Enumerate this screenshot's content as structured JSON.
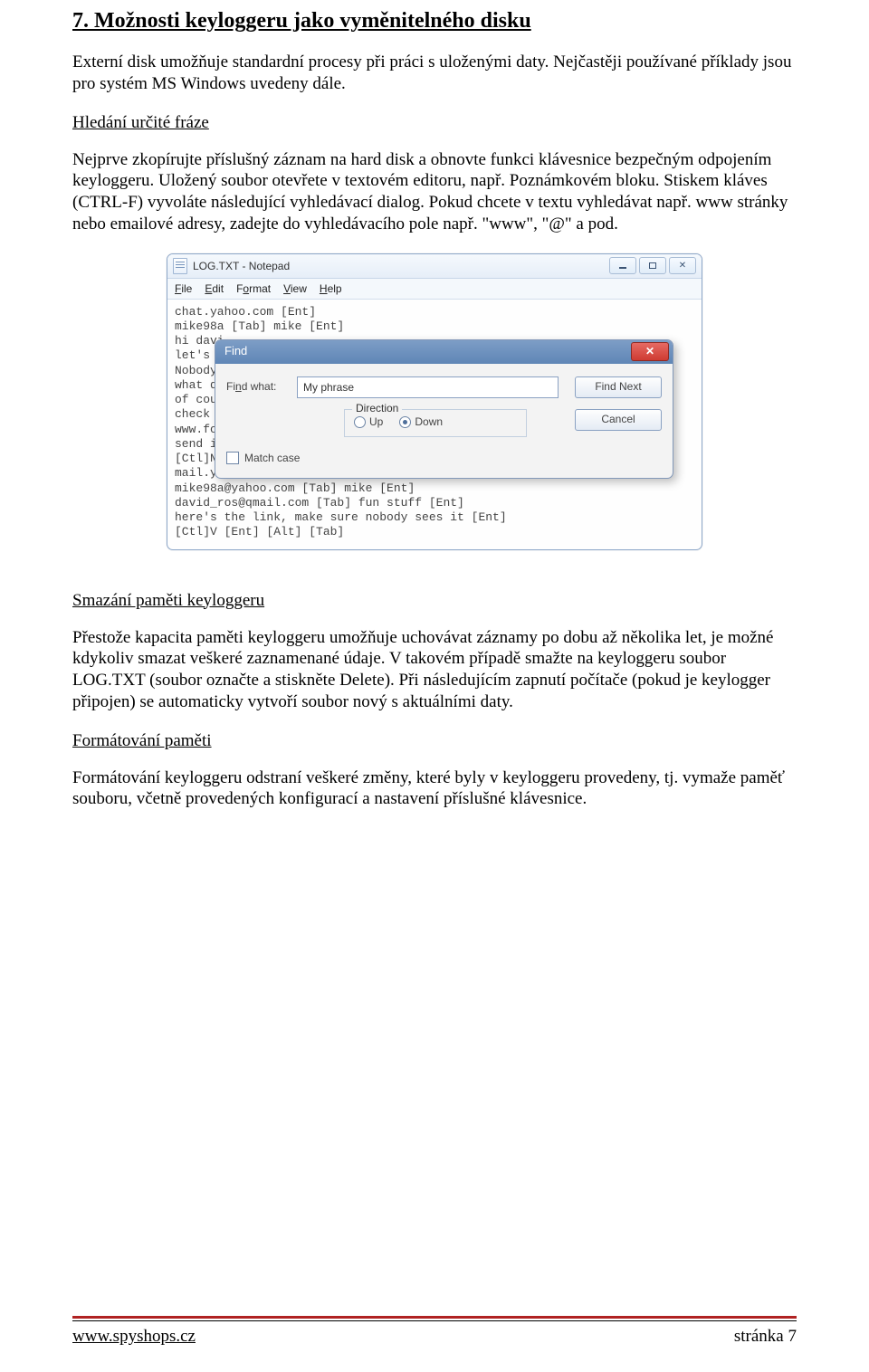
{
  "heading_number": "7.",
  "heading_text": "Možnosti keyloggeru jako vyměnitelného disku",
  "para1": "Externí disk umožňuje standardní procesy při práci s uloženými daty. Nejčastěji používané příklady jsou pro systém MS Windows uvedeny dále.",
  "sub1": "Hledání určité fráze",
  "para2": "Nejprve zkopírujte příslušný záznam na hard disk a obnovte funkci klávesnice bezpečným odpojením keyloggeru. Uložený soubor otevřete v textovém editoru, např. Poznámkovém bloku. Stiskem kláves (CTRL-F) vyvoláte následující vyhledávací dialog. Pokud chcete v textu vyhledávat např. www stránky nebo emailové adresy, zadejte do vyhledávacího pole např. \"www\", \"@\" a pod.",
  "sub2": "Smazání paměti keyloggeru",
  "para3": "Přestože kapacita paměti keyloggeru umožňuje uchovávat záznamy po dobu až několika let, je možné kdykoliv smazat veškeré zaznamenané údaje. V takovém případě smažte na keyloggeru soubor LOG.TXT (soubor označte a stiskněte Delete). Při následujícím zapnutí počítače (pokud je keylogger připojen) se automaticky vytvoří soubor nový s aktuálními daty.",
  "sub3": "Formátování paměti",
  "para4": "Formátování keyloggeru odstraní veškeré změny, které byly v keyloggeru provedeny, tj. vymaže paměť souboru, včetně provedených konfigurací a nastavení příslušné klávesnice.",
  "notepad": {
    "title": "LOG.TXT - Notepad",
    "menu": {
      "file": "File",
      "edit": "Edit",
      "format": "Format",
      "view": "View",
      "help": "Help"
    },
    "body_lines": [
      "chat.yahoo.com [Ent]",
      "mike98a [Tab] mike [Ent]",
      "hi davi",
      "let's s",
      "Nobody",
      "what do",
      "of cour",
      "check o",
      "www.for",
      "send it",
      "[Ctl]N",
      "mail.ya",
      "mike98a@yahoo.com [Tab] mike [Ent]",
      "david_ros@qmail.com [Tab] fun stuff [Ent]",
      "here's the link, make sure nobody sees it [Ent]",
      "[Ctl]V [Ent] [Alt] [Tab]"
    ]
  },
  "find": {
    "title": "Find",
    "label": "Find what:",
    "value": "My phrase",
    "find_next": "Find Next",
    "cancel": "Cancel",
    "direction": "Direction",
    "up": "Up",
    "down": "Down",
    "match_case": "Match case"
  },
  "footer": {
    "link": "www.spyshops.cz",
    "page": "stránka 7"
  }
}
